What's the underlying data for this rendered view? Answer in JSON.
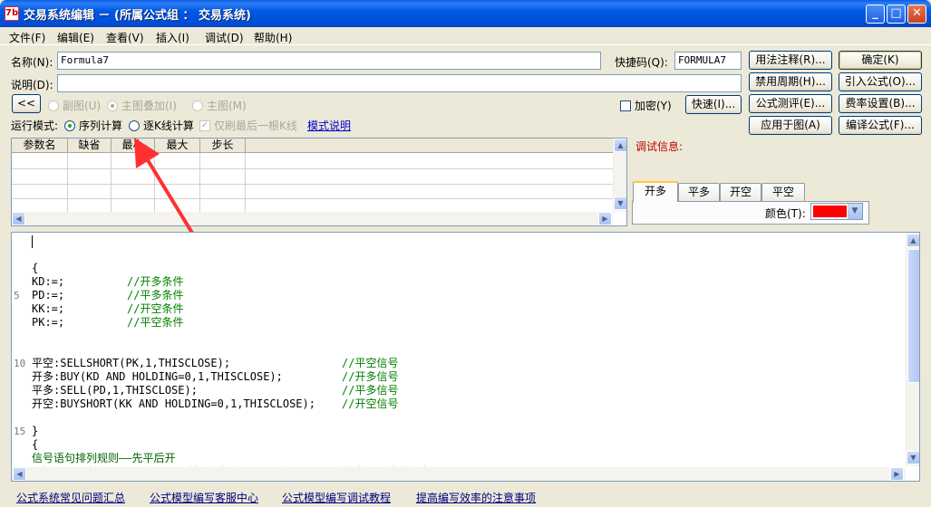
{
  "window": {
    "title": "交易系统编辑 － (所属公式组 ： 交易系统)",
    "icon_text": "7b",
    "minimize": "_",
    "maximize": "□",
    "close": "✕"
  },
  "menu": [
    "文件(F)",
    "编辑(E)",
    "查看(V)",
    "插入(I)",
    "调试(D)",
    "帮助(H)"
  ],
  "form": {
    "name_label": "名称(N):",
    "name_value": "Formula7",
    "shortcut_label": "快捷码(Q):",
    "shortcut_value": "FORMULA7",
    "desc_label": "说明(D):",
    "desc_value": ""
  },
  "buttons": {
    "usage_note": "用法注释(R)...",
    "confirm": "确定(K)",
    "disable_period": "禁用周期(H)...",
    "import_formula": "引入公式(O)...",
    "formula_test": "公式测评(E)...",
    "fee_settings": "费率设置(B)...",
    "apply_chart": "应用于图(A)",
    "compile": "编译公式(F)...",
    "quick": "快速(I)...",
    "collapse": "<<"
  },
  "options": {
    "subchart": "副图(U)",
    "main_overlay": "主图叠加(I)",
    "main_chart": "主图(M)",
    "encrypt": "加密(Y)",
    "run_mode_label": "运行模式:",
    "seq_calc": "序列计算",
    "bar_calc": "逐K线计算",
    "last_bar_only": "仅刷最后一根K线",
    "mode_help": "模式说明"
  },
  "params": {
    "headers": [
      "参数名",
      "缺省",
      "最小",
      "最大",
      "步长"
    ]
  },
  "debug": {
    "label": "调试信息:",
    "tabs": [
      "开多",
      "平多",
      "开空",
      "平空"
    ],
    "color_label": "颜色(T):",
    "color_value": "#ff0000"
  },
  "editor": {
    "lines": [
      {
        "no": "",
        "code": "",
        "comment": ""
      },
      {
        "no": "",
        "code": "",
        "comment": ""
      },
      {
        "no": "",
        "code": "{",
        "comment": ""
      },
      {
        "no": "",
        "code": "KD:=;",
        "comment": "//开多条件"
      },
      {
        "no": "5",
        "code": "PD:=;",
        "comment": "//平多条件"
      },
      {
        "no": "",
        "code": "KK:=;",
        "comment": "//开空条件"
      },
      {
        "no": "",
        "code": "PK:=;",
        "comment": "//平空条件"
      },
      {
        "no": "",
        "code": "",
        "comment": ""
      },
      {
        "no": "",
        "code": "",
        "comment": ""
      },
      {
        "no": "10",
        "code": "平空:SELLSHORT(PK,1,THISCLOSE);",
        "comment": "//平空信号"
      },
      {
        "no": "",
        "code": "开多:BUY(KD AND HOLDING=0,1,THISCLOSE);",
        "comment": "//开多信号"
      },
      {
        "no": "",
        "code": "平多:SELL(PD,1,THISCLOSE);",
        "comment": "//平多信号"
      },
      {
        "no": "",
        "code": "开空:BUYSHORT(KK AND HOLDING=0,1,THISCLOSE);",
        "comment": "//开空信号"
      },
      {
        "no": "",
        "code": "",
        "comment": ""
      },
      {
        "no": "15",
        "code": "}",
        "comment": ""
      },
      {
        "no": "",
        "code": "{",
        "comment": ""
      },
      {
        "no": "",
        "code": "信号语句排列规则——先平后开",
        "comment": ""
      },
      {
        "no": "",
        "code": "“费率设置”按钮——用于合理设置模型“费率”，以便在图形上正确输出如下能力信息",
        "comment": ""
      }
    ]
  },
  "footer": [
    "公式系统常见问题汇总",
    "公式模型编写客服中心",
    "公式模型编写调试教程",
    "提高编写效率的注意事项"
  ]
}
